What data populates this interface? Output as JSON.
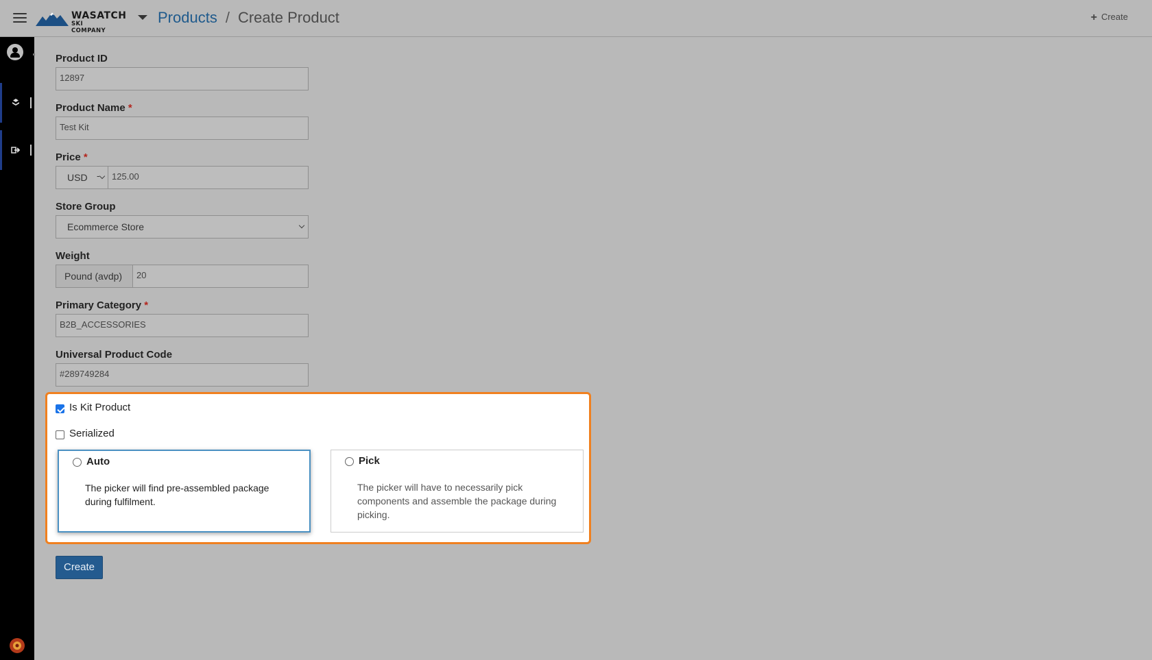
{
  "header": {
    "logo_name": "WASATCH",
    "logo_sub": "SKI COMPANY",
    "breadcrumb_link": "Products",
    "breadcrumb_sep": "/",
    "breadcrumb_current": "Create Product",
    "create_label": "Create"
  },
  "sidebar": {
    "items": [
      {
        "icon": "boxes-icon"
      },
      {
        "icon": "sign-out-icon"
      }
    ],
    "accent": "#1f3d8a"
  },
  "form": {
    "product_id": {
      "label": "Product ID",
      "value": "12897"
    },
    "product_name": {
      "label": "Product Name",
      "required": "*",
      "value": "Test Kit"
    },
    "price": {
      "label": "Price",
      "required": "*",
      "currency": "USD",
      "currency_suffix": "-",
      "value": "125.00"
    },
    "store_group": {
      "label": "Store Group",
      "value": "Ecommerce Store"
    },
    "weight": {
      "label": "Weight",
      "unit": "Pound (avdp)",
      "value": "20"
    },
    "primary_category": {
      "label": "Primary Category",
      "required": "*",
      "value": "B2B_ACCESSORIES"
    },
    "upc": {
      "label": "Universal Product Code",
      "value": "#289749284"
    },
    "is_kit": {
      "label": "Is Kit Product",
      "checked": true
    },
    "serialized": {
      "label": "Serialized",
      "checked": false
    },
    "kit_options": {
      "auto": {
        "title": "Auto",
        "description": "The picker will find pre-assembled package during fulfilment."
      },
      "pick": {
        "title": "Pick",
        "description": "The picker will have to necessarily pick components and assemble the package during picking."
      }
    },
    "submit_label": "Create"
  },
  "colors": {
    "highlight": "#f0801f",
    "primary": "#245b8f",
    "link": "#1f5a8c",
    "required": "#b3261e"
  }
}
